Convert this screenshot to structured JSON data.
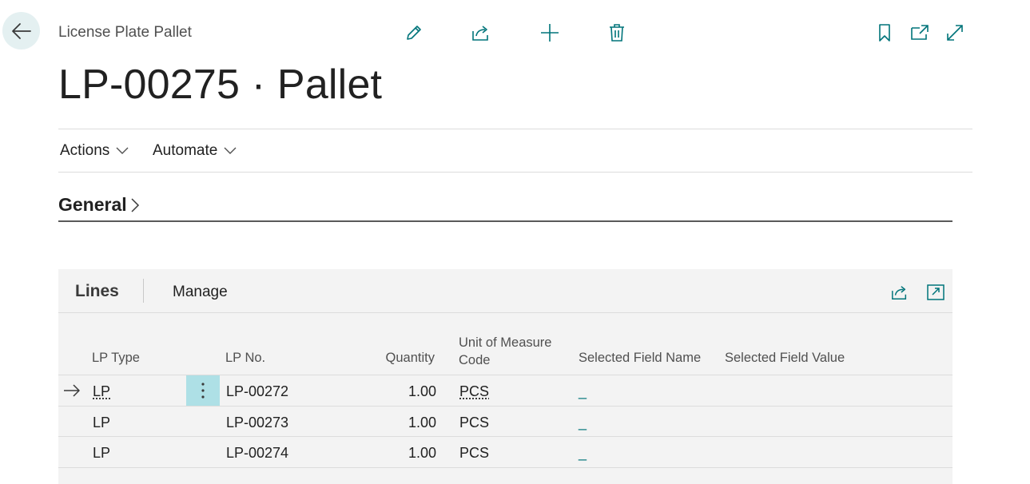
{
  "header": {
    "breadcrumb": "License Plate Pallet",
    "title": "LP-00275 · Pallet"
  },
  "toolbar": {
    "edit_icon": "pencil-icon",
    "share_icon": "share-icon",
    "new_icon": "plus-icon",
    "delete_icon": "trash-icon",
    "bookmark_icon": "bookmark-icon",
    "open_new_window_icon": "open-in-new-window-icon",
    "expand_icon": "expand-icon"
  },
  "menu": {
    "actions_label": "Actions",
    "automate_label": "Automate"
  },
  "general": {
    "title": "General"
  },
  "lines": {
    "tab_label": "Lines",
    "manage_label": "Manage",
    "columns": {
      "lp_type": "LP Type",
      "lp_no": "LP No.",
      "quantity": "Quantity",
      "uom_line1": "Unit of Measure",
      "uom_line2": "Code",
      "selected_field_name": "Selected Field Name",
      "selected_field_value": "Selected Field Value"
    },
    "rows": [
      {
        "lp_type": "LP",
        "lp_no": "LP-00272",
        "quantity": "1.00",
        "uom": "PCS",
        "field_name": "_",
        "field_value": ""
      },
      {
        "lp_type": "LP",
        "lp_no": "LP-00273",
        "quantity": "1.00",
        "uom": "PCS",
        "field_name": "_",
        "field_value": ""
      },
      {
        "lp_type": "LP",
        "lp_no": "LP-00274",
        "quantity": "1.00",
        "uom": "PCS",
        "field_name": "_",
        "field_value": ""
      }
    ]
  },
  "colors": {
    "accent": "#00747a",
    "selected_cell": "#aee0e6",
    "back_button_bg": "#e4f0f1",
    "panel_bg": "#f3f3f3"
  }
}
